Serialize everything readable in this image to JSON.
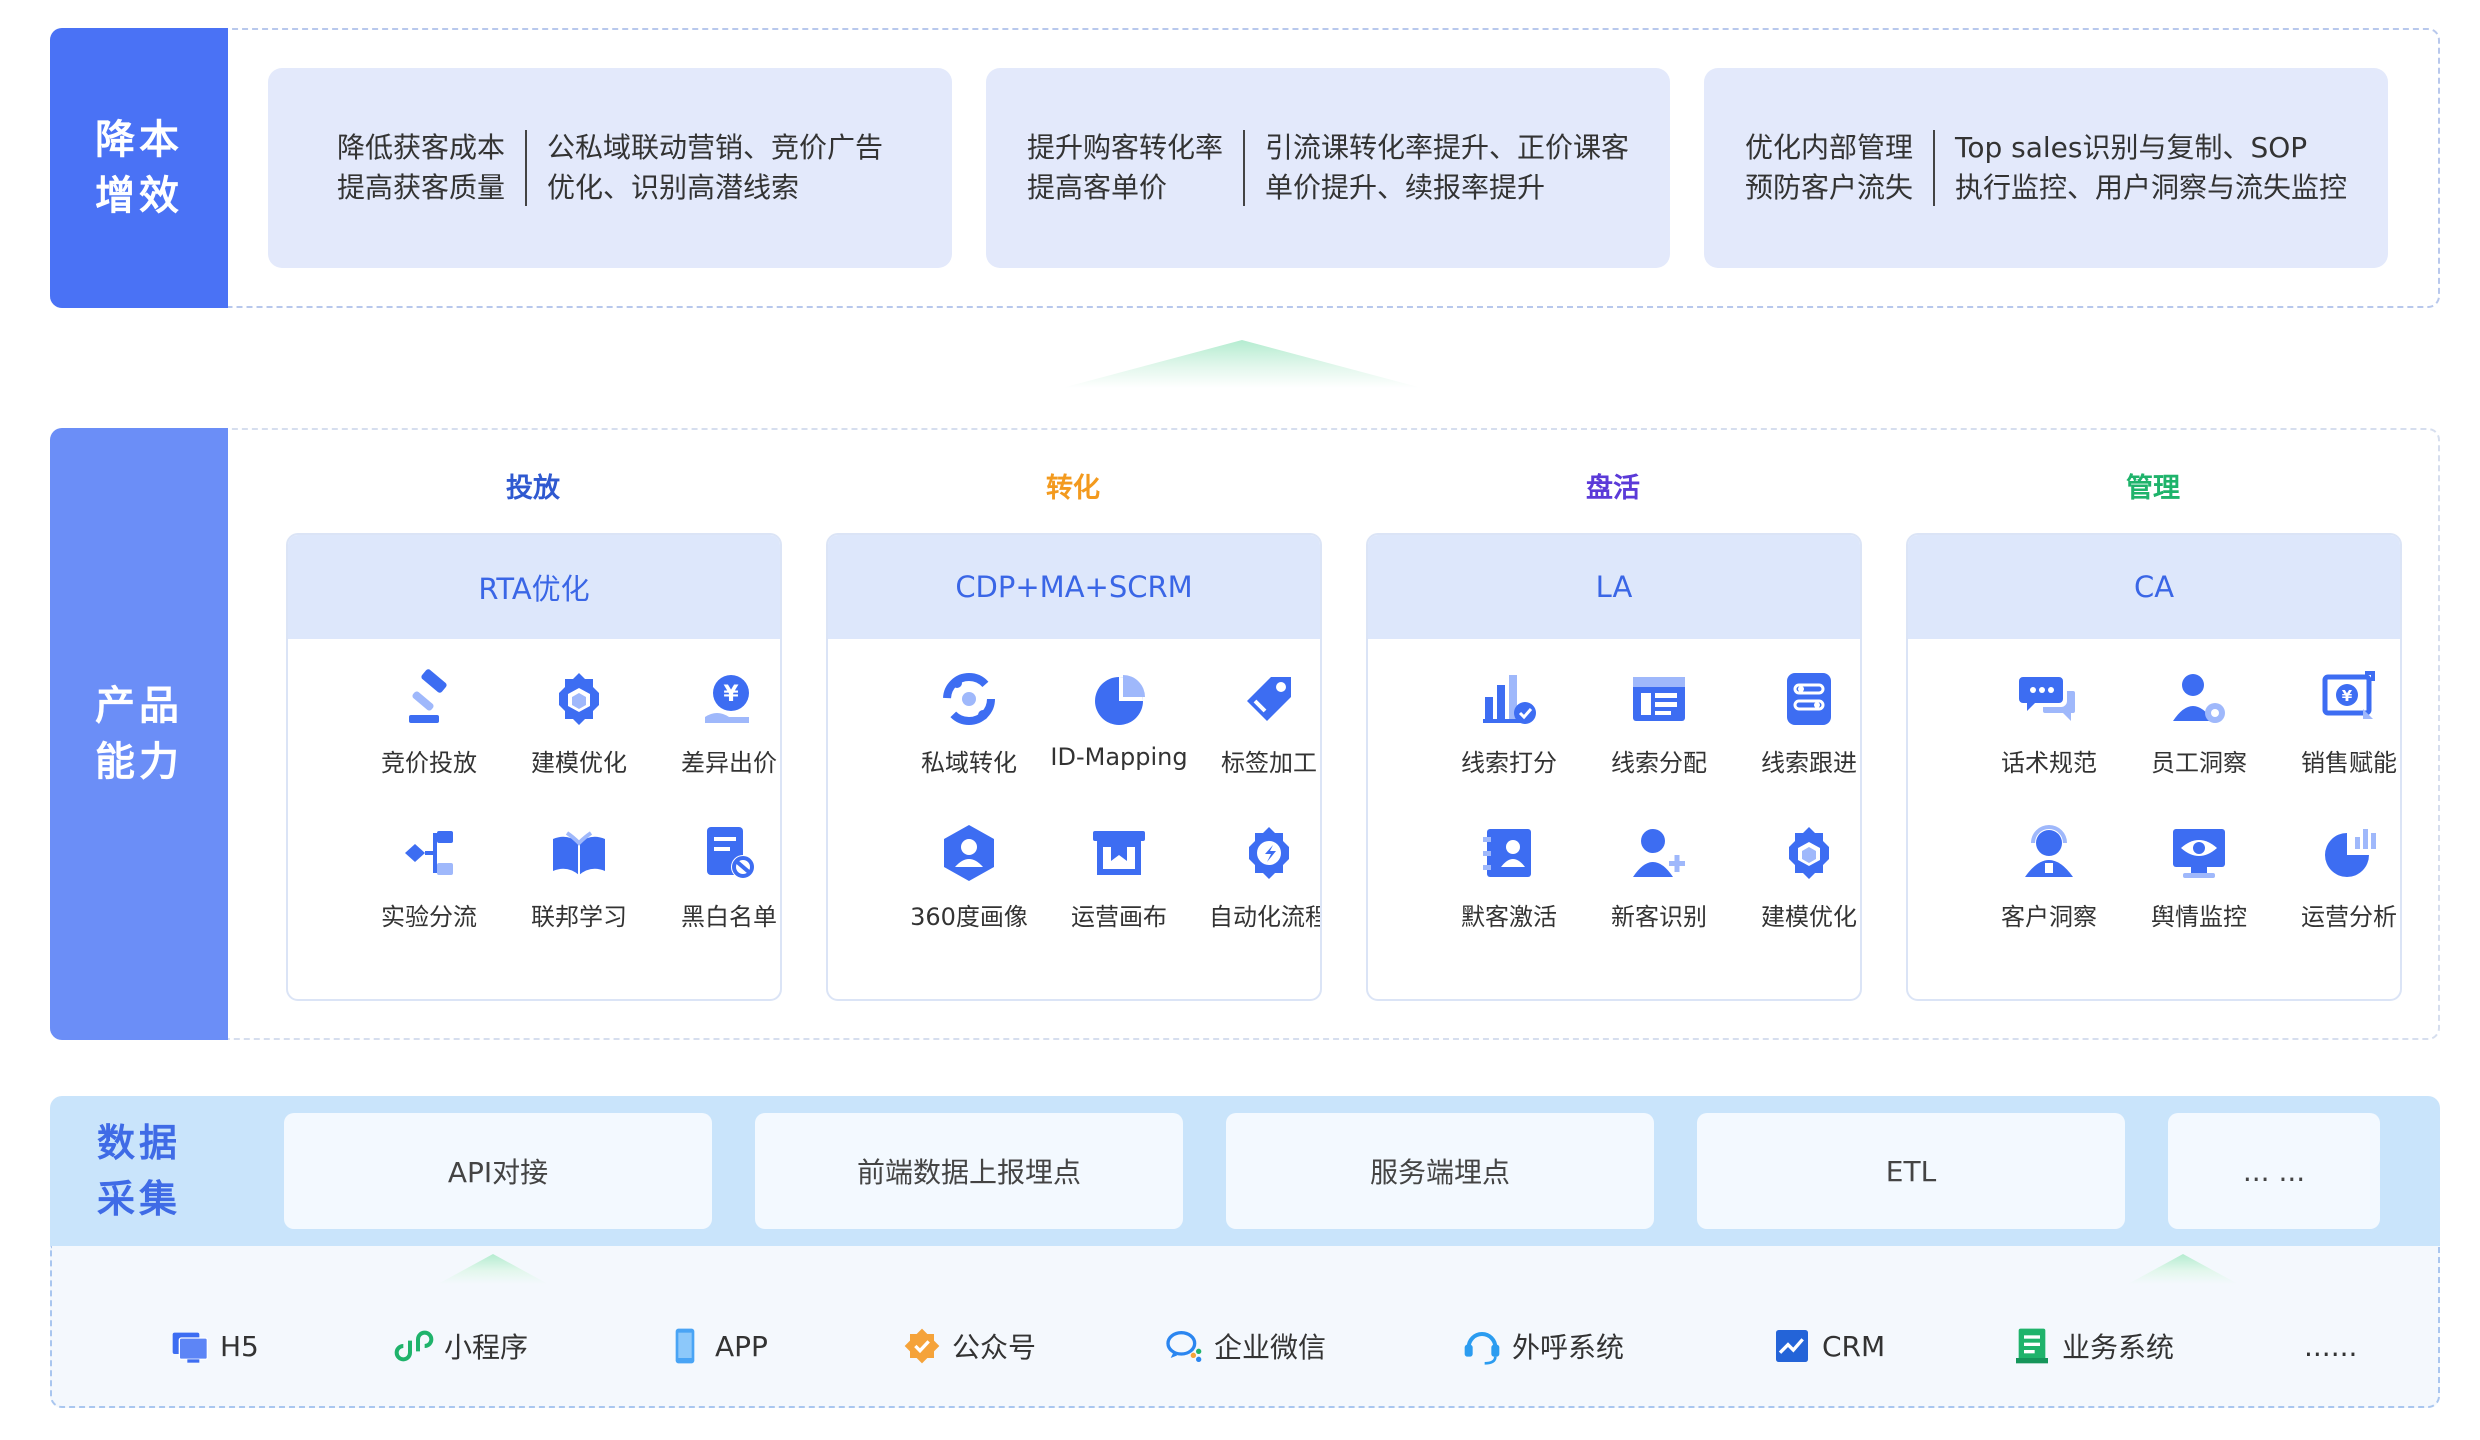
{
  "colors": {
    "primary": "#4a72f5",
    "product_label": "#6b8ef7",
    "card_bg": "#e3e9fb",
    "product_head_bg": "#dde7fb",
    "icon_blue": "#3d6df2",
    "data_band": "#c9e4fb",
    "cat_toufang": "#2f59d0",
    "cat_zhuanhua": "#f39a1e",
    "cat_panhuo": "#5b3ad8",
    "cat_guanli": "#1fb36b"
  },
  "row1": {
    "label": "降本\n增效",
    "cards": [
      {
        "left": "降低获客成本\n提高获客质量",
        "right": "公私域联动营销、竞价广告\n优化、识别高潜线索"
      },
      {
        "left": "提升购客转化率\n提高客单价",
        "right": "引流课转化率提升、正价课客\n单价提升、续报率提升"
      },
      {
        "left": "优化内部管理\n预防客户流失",
        "right": "Top sales识别与复制、SOP\n执行监控、用户洞察与流失监控"
      }
    ]
  },
  "row2": {
    "label": "产品\n能力",
    "categories": [
      {
        "title": "投放",
        "color": "#2f59d0"
      },
      {
        "title": "转化",
        "color": "#f39a1e"
      },
      {
        "title": "盘活",
        "color": "#5b3ad8"
      },
      {
        "title": "管理",
        "color": "#1fb36b"
      }
    ],
    "products": [
      {
        "name": "RTA优化",
        "features": [
          {
            "label": "竞价投放",
            "icon": "gavel-icon"
          },
          {
            "label": "建模优化",
            "icon": "gear-cube-icon"
          },
          {
            "label": "差异出价",
            "icon": "yen-hand-icon"
          },
          {
            "label": "实验分流",
            "icon": "split-flow-icon"
          },
          {
            "label": "联邦学习",
            "icon": "open-book-icon"
          },
          {
            "label": "黑白名单",
            "icon": "blocked-list-icon"
          }
        ]
      },
      {
        "name": "CDP+MA+SCRM",
        "features": [
          {
            "label": "私域转化",
            "icon": "convert-cycle-icon"
          },
          {
            "label": "ID-Mapping",
            "icon": "pie-icon"
          },
          {
            "label": "标签加工",
            "icon": "tag-icon"
          },
          {
            "label": "360度画像",
            "icon": "hexagon-user-icon"
          },
          {
            "label": "运营画布",
            "icon": "canvas-board-icon"
          },
          {
            "label": "自动化流程",
            "icon": "gear-flow-icon"
          }
        ]
      },
      {
        "name": "LA",
        "features": [
          {
            "label": "线索打分",
            "icon": "score-chart-icon"
          },
          {
            "label": "线索分配",
            "icon": "distribution-board-icon"
          },
          {
            "label": "线索跟进",
            "icon": "follow-doc-icon"
          },
          {
            "label": "默客激活",
            "icon": "contact-book-icon"
          },
          {
            "label": "新客识别",
            "icon": "user-add-icon"
          },
          {
            "label": "建模优化",
            "icon": "gear-cube-icon"
          }
        ]
      },
      {
        "name": "CA",
        "features": [
          {
            "label": "话术规范",
            "icon": "chat-bubbles-icon"
          },
          {
            "label": "员工洞察",
            "icon": "user-gear-icon"
          },
          {
            "label": "销售赋能",
            "icon": "money-monitor-icon"
          },
          {
            "label": "客户洞察",
            "icon": "customer-icon"
          },
          {
            "label": "舆情监控",
            "icon": "eye-monitor-icon"
          },
          {
            "label": "运营分析",
            "icon": "pie-bar-icon"
          }
        ]
      }
    ]
  },
  "row3": {
    "label": "数据\n采集",
    "methods": [
      "API对接",
      "前端数据上报埋点",
      "服务端埋点",
      "ETL",
      "... ..."
    ],
    "sources": [
      {
        "label": "H5",
        "icon": "h5-screen-icon"
      },
      {
        "label": "小程序",
        "icon": "mini-program-icon"
      },
      {
        "label": "APP",
        "icon": "phone-icon"
      },
      {
        "label": "公众号",
        "icon": "official-account-icon"
      },
      {
        "label": "企业微信",
        "icon": "wecom-icon"
      },
      {
        "label": "外呼系统",
        "icon": "headset-icon"
      },
      {
        "label": "CRM",
        "icon": "crm-icon"
      },
      {
        "label": "业务系统",
        "icon": "business-system-icon"
      },
      {
        "label": "......",
        "icon": ""
      }
    ]
  }
}
